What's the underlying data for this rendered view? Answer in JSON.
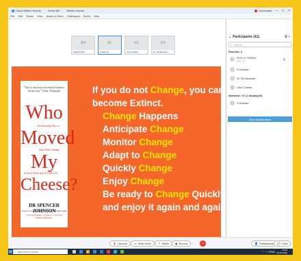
{
  "window": {
    "tabs": [
      {
        "label": "Cisco Webex Events"
      },
      {
        "label": "Saniti WK"
      },
      {
        "label": "Webex events"
      }
    ],
    "connected_label": "Connected",
    "menu": [
      "File",
      "Edit",
      "Share",
      "View",
      "Audio & Video",
      "Participant",
      "Event",
      "Help"
    ]
  },
  "thumbnails": [
    {
      "initials": "SH",
      "name": "SHAIKH MD",
      "active": false
    },
    {
      "initials": "SC",
      "name": "S Dhiman",
      "active": true
    },
    {
      "initials": "UC",
      "name": "Uma Chakra",
      "active": false
    },
    {
      "initials": "DY",
      "name": "Dr Gil Saramah",
      "active": false
    }
  ],
  "book": {
    "quote": "\"One of the most successful business books ever.\" Daily Telegraph",
    "word1": "Who",
    "word2": "Moved",
    "word3": "My",
    "word4": "Cheese?",
    "sub1": "An Amazing Way to",
    "sub2": "Deal With Change",
    "sub3": "in Your Work and in Your Life",
    "author": "DR SPENCER JOHNSON",
    "foreword": "Foreword by KENNETH BLANCHARD PhD",
    "coauthor": "Joint bestselling co-author of The One Minute Manager"
  },
  "slide": {
    "line1_a": "If you do not ",
    "line1_b": "Change",
    "line1_c": ", you can",
    "line2": "become Extinct.",
    "l3a": "Change",
    "l3b": " Happens",
    "l4a": "Anticipate ",
    "l4b": "Change",
    "l5a": "Monitor ",
    "l5b": "Change",
    "l6a": "Adapt to ",
    "l6b": "Change",
    "l7a": "Quickly ",
    "l7b": "Change",
    "l8a": "Enjoy ",
    "l8b": "Change",
    "l9a": "Be ready to ",
    "l9b": "Change",
    "l9c": " Quickly",
    "l10": "and enjoy it again and again"
  },
  "participants": {
    "title": "Participants (41)",
    "search_placeholder": "Search",
    "panelists_label": "Panelist: 4",
    "panelists": [
      {
        "name": "RITU H. FIROZ",
        "sub": "Host, me"
      },
      {
        "name": "S Dhiman"
      },
      {
        "name": "Dr Gil Saramah"
      },
      {
        "name": "Uma Chakra"
      }
    ],
    "attendees_label": "Attendee: 37 (1 displayed)",
    "attendees": [
      {
        "name": "S Dhiman"
      }
    ],
    "view_all_label": "View all attendees"
  },
  "meeting_bar": {
    "unmute": "Unmute",
    "start_video": "Start video",
    "share": "Share",
    "record": "Record",
    "more": "···",
    "leave": "×",
    "participants": "Participants",
    "chat": "Chat"
  },
  "taskbar": {
    "search_placeholder": "Type here to search",
    "time": "16:48",
    "date": "09-04-2022",
    "lang": "ENG"
  },
  "colors": {
    "slide_bg": "#f4662a",
    "highlight_text": "#ffe400",
    "book_title": "#d4291b",
    "border": "#f5c518",
    "leave": "#e23b2e"
  }
}
